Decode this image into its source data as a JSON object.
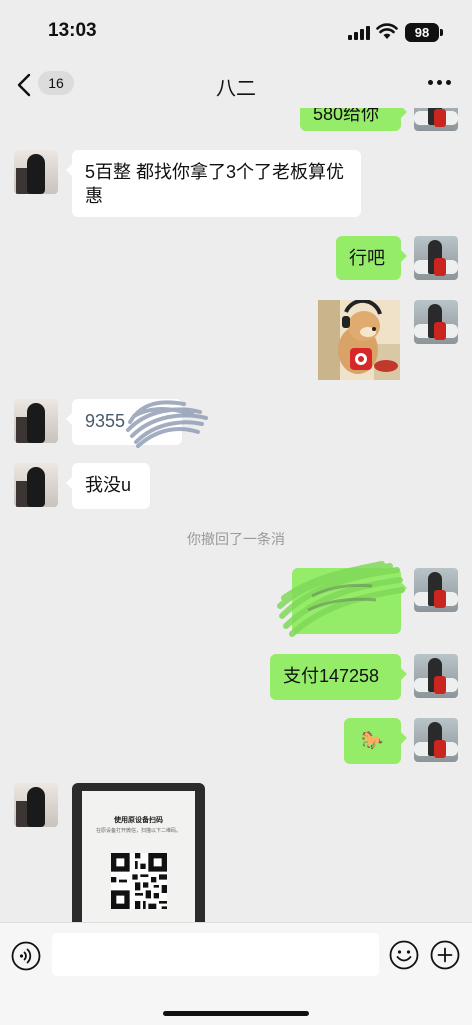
{
  "status": {
    "time": "13:03",
    "battery": "98"
  },
  "header": {
    "title": "八二",
    "unread_count": "16"
  },
  "messages": [
    {
      "side": "sent",
      "text": "580给你"
    },
    {
      "side": "received",
      "text": "5百整 都找你拿了3个了老板算优惠"
    },
    {
      "side": "sent",
      "text": "行吧"
    },
    {
      "side": "sent",
      "type": "sticker"
    },
    {
      "side": "received",
      "text": "9355"
    },
    {
      "side": "received",
      "text": "我没u"
    },
    {
      "side": "sent",
      "text": "支付147258"
    },
    {
      "side": "sent",
      "text": "🐎"
    },
    {
      "side": "received",
      "type": "image",
      "image_title": "使用原设备扫码",
      "image_subtitle": "在原设备打开微信，扫描以下二维码。"
    }
  ],
  "system_notice": "你撤回了一条消",
  "input": {
    "placeholder": ""
  },
  "colors": {
    "sent_bubble": "#95ec69",
    "received_bubble": "#ffffff",
    "background": "#ededed"
  },
  "icons": [
    "back-icon",
    "more-icon",
    "voice-icon",
    "emoji-icon",
    "plus-icon",
    "signal-icon",
    "wifi-icon",
    "battery-icon"
  ]
}
